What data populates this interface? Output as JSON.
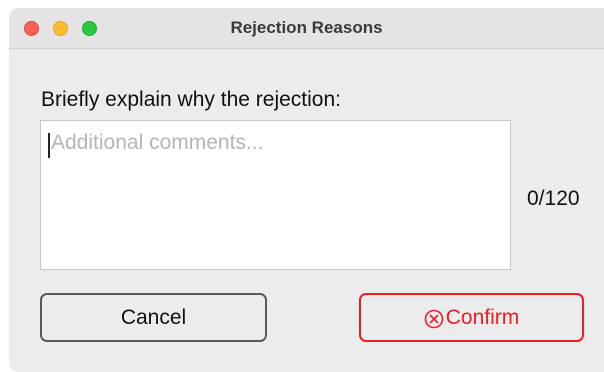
{
  "window": {
    "title": "Rejection Reasons"
  },
  "form": {
    "prompt": "Briefly explain why the rejection:",
    "comment_value": "",
    "comment_placeholder": "Additional comments...",
    "char_counter": "0/120"
  },
  "buttons": {
    "cancel_label": "Cancel",
    "confirm_label": "Confirm",
    "confirm_icon": "circle-x-icon"
  },
  "colors": {
    "confirm_accent": "#ee1c25",
    "close_light": "#fe5f57",
    "minimize_light": "#febc2e",
    "zoom_light": "#28c840"
  }
}
